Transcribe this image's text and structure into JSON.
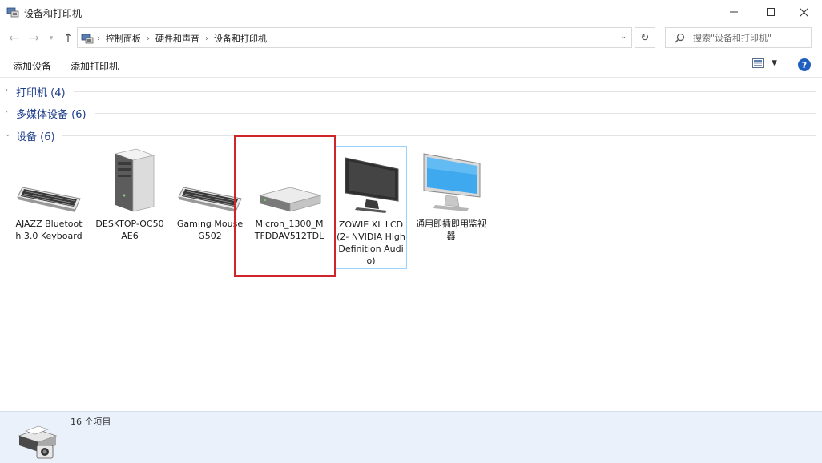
{
  "window": {
    "title": "设备和打印机",
    "minimize_icon": "minimize-icon",
    "maximize_icon": "maximize-icon",
    "close_icon": "close-icon"
  },
  "address": {
    "crumbs": [
      "控制面板",
      "硬件和声音",
      "设备和打印机"
    ],
    "search_placeholder": "搜索\"设备和打印机\""
  },
  "commands": {
    "add_device": "添加设备",
    "add_printer": "添加打印机"
  },
  "groups": {
    "printers": "打印机 (4)",
    "multimedia": "多媒体设备 (6)",
    "devices": "设备 (6)"
  },
  "devices": [
    {
      "label": "AJAZZ Bluetooth 3.0 Keyboard",
      "icon": "keyboard-icon"
    },
    {
      "label": "DESKTOP-OC50AE6",
      "icon": "computer-tower-icon"
    },
    {
      "label": "Gaming Mouse G502",
      "icon": "keyboard-icon"
    },
    {
      "label": "Micron_1300_MTFDDAV512TDL",
      "icon": "drive-icon"
    },
    {
      "label": "ZOWIE XL LCD (2- NVIDIA High Definition Audio)",
      "icon": "monitor-dark-icon"
    },
    {
      "label": "通用即插即用监视器",
      "icon": "monitor-blue-icon"
    }
  ],
  "status": {
    "count": "16 个项目"
  },
  "colors": {
    "group_label": "#1c3d8a",
    "highlight": "#d1232a",
    "status_bg": "#eaf1fb",
    "help": "#1f5fbf"
  }
}
